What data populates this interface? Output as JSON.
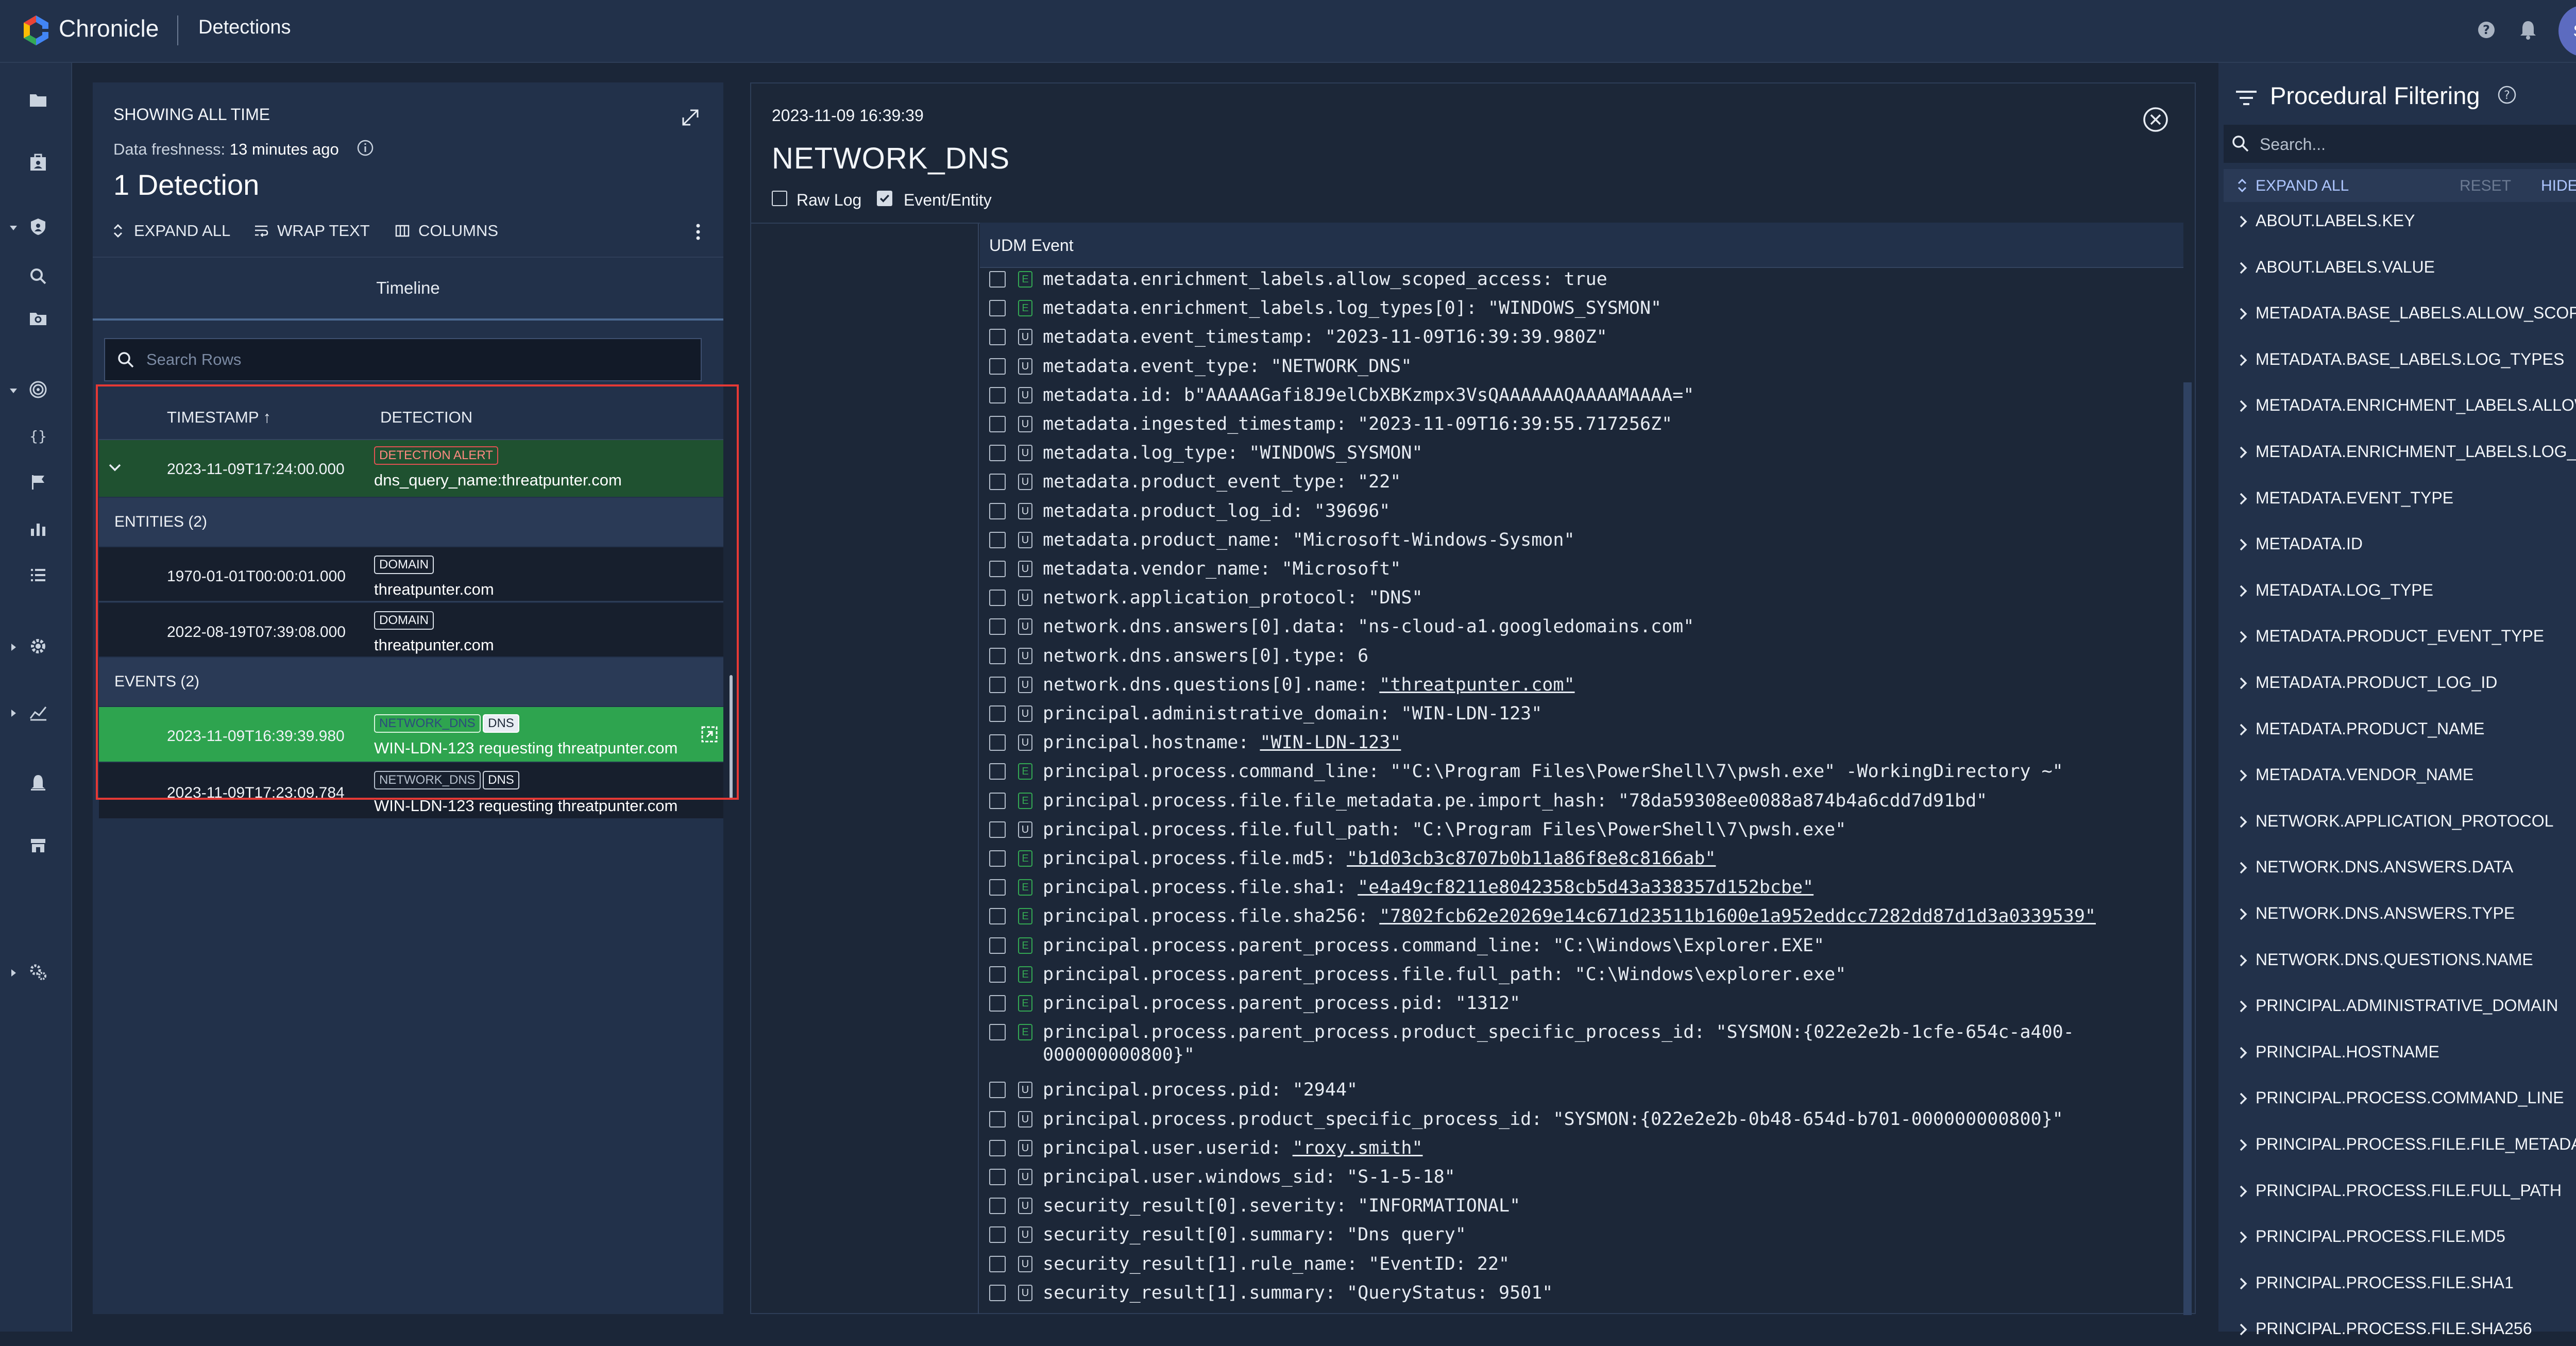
{
  "header": {
    "brand": "Chronicle",
    "page_title": "Detections",
    "avatar_initials": "SA",
    "brand_colors": [
      "#4285f4",
      "#ea4335",
      "#fbbc04",
      "#34a853"
    ]
  },
  "rail_icons": [
    "folder-icon",
    "case-icon",
    "shield-icon",
    "search-icon",
    "folder-search-icon",
    "target-icon",
    "curly-braces-icon",
    "flag-icon",
    "bar-chart-icon",
    "list-icon",
    "gear-icon",
    "line-chart-icon",
    "bell-icon",
    "store-icon",
    "settings-gears-icon"
  ],
  "left": {
    "showing": "SHOWING ALL TIME",
    "freshness_label": "Data freshness:",
    "freshness_value": "13 minutes ago",
    "count_label": "1 Detection",
    "toolbar": {
      "expand_all": "EXPAND ALL",
      "wrap_text": "WRAP TEXT",
      "columns": "COLUMNS"
    },
    "tab": "Timeline",
    "search_placeholder": "Search Rows",
    "columns": {
      "timestamp": "TIMESTAMP ↑",
      "detection": "DETECTION"
    },
    "detection_row": {
      "timestamp": "2023-11-09T17:24:00.000",
      "badge": "DETECTION ALERT",
      "value": "dns_query_name:threatpunter.com"
    },
    "entities_header": "ENTITIES (2)",
    "entities": [
      {
        "timestamp": "1970-01-01T00:00:01.000",
        "badge": "DOMAIN",
        "value": "threatpunter.com"
      },
      {
        "timestamp": "2022-08-19T07:39:08.000",
        "badge": "DOMAIN",
        "value": "threatpunter.com"
      }
    ],
    "events_header": "EVENTS (2)",
    "events": [
      {
        "timestamp": "2023-11-09T16:39:39.980",
        "badge1": "NETWORK_DNS",
        "badge2": "DNS",
        "value": "WIN-LDN-123 requesting threatpunter.com"
      },
      {
        "timestamp": "2023-11-09T17:23:09.784",
        "badge1": "NETWORK_DNS",
        "badge2": "DNS",
        "value": "WIN-LDN-123 requesting threatpunter.com"
      }
    ]
  },
  "middle": {
    "event_date": "2023-11-09 16:39:39",
    "event_title": "NETWORK_DNS",
    "raw_log": "Raw Log",
    "event_entity": "Event/Entity",
    "udm_header": "UDM Event",
    "fields": [
      {
        "tag": "E",
        "text": "metadata.enrichment_labels.allow_scoped_access: true"
      },
      {
        "tag": "E",
        "text": "metadata.enrichment_labels.log_types[0]: \"WINDOWS_SYSMON\""
      },
      {
        "tag": "U",
        "text": "metadata.event_timestamp: \"2023-11-09T16:39:39.980Z\""
      },
      {
        "tag": "U",
        "text": "metadata.event_type: \"NETWORK_DNS\""
      },
      {
        "tag": "U",
        "text": "metadata.id: b\"AAAAAGafi8J9elCbXBKzmpx3VsQAAAAAAQAAAAMAAAA=\""
      },
      {
        "tag": "U",
        "text": "metadata.ingested_timestamp: \"2023-11-09T16:39:55.717256Z\""
      },
      {
        "tag": "U",
        "text": "metadata.log_type: \"WINDOWS_SYSMON\""
      },
      {
        "tag": "U",
        "text": "metadata.product_event_type: \"22\""
      },
      {
        "tag": "U",
        "text": "metadata.product_log_id: \"39696\""
      },
      {
        "tag": "U",
        "text": "metadata.product_name: \"Microsoft-Windows-Sysmon\""
      },
      {
        "tag": "U",
        "text": "metadata.vendor_name: \"Microsoft\""
      },
      {
        "tag": "U",
        "text": "network.application_protocol: \"DNS\""
      },
      {
        "tag": "U",
        "text": "network.dns.answers[0].data: \"ns-cloud-a1.googledomains.com\""
      },
      {
        "tag": "U",
        "text": "network.dns.answers[0].type: 6"
      },
      {
        "tag": "U",
        "text": "network.dns.questions[0].name: ",
        "link": "\"threatpunter.com\""
      },
      {
        "tag": "U",
        "text": "principal.administrative_domain: \"WIN-LDN-123\""
      },
      {
        "tag": "U",
        "text": "principal.hostname: ",
        "link": "\"WIN-LDN-123\""
      },
      {
        "tag": "E",
        "text": "principal.process.command_line: \"\"C:\\Program Files\\PowerShell\\7\\pwsh.exe\" -WorkingDirectory ~\""
      },
      {
        "tag": "E",
        "text": "principal.process.file.file_metadata.pe.import_hash: \"78da59308ee0088a874b4a6cdd7d91bd\""
      },
      {
        "tag": "U",
        "text": "principal.process.file.full_path: \"C:\\Program Files\\PowerShell\\7\\pwsh.exe\""
      },
      {
        "tag": "E",
        "text": "principal.process.file.md5: ",
        "link": "\"b1d03cb3c8707b0b11a86f8e8c8166ab\""
      },
      {
        "tag": "E",
        "text": "principal.process.file.sha1: ",
        "link": "\"e4a49cf8211e8042358cb5d43a338357d152bcbe\""
      },
      {
        "tag": "E",
        "text": "principal.process.file.sha256: ",
        "link": "\"7802fcb62e20269e14c671d23511b1600e1a952eddcc7282dd87d1d3a0339539\""
      },
      {
        "tag": "E",
        "text": "principal.process.parent_process.command_line: \"C:\\Windows\\Explorer.EXE\""
      },
      {
        "tag": "E",
        "text": "principal.process.parent_process.file.full_path: \"C:\\Windows\\explorer.exe\""
      },
      {
        "tag": "E",
        "text": "principal.process.parent_process.pid: \"1312\""
      },
      {
        "tag": "E",
        "text": "principal.process.parent_process.product_specific_process_id: \"SYSMON:{022e2e2b-1cfe-654c-a400-",
        "text2": "000000000800}\""
      },
      {
        "tag": "U",
        "text": "principal.process.pid: \"2944\""
      },
      {
        "tag": "U",
        "text": "principal.process.product_specific_process_id: \"SYSMON:{022e2e2b-0b48-654d-b701-000000000800}\""
      },
      {
        "tag": "U",
        "text": "principal.user.userid: ",
        "link": "\"roxy.smith\""
      },
      {
        "tag": "U",
        "text": "principal.user.windows_sid: \"S-1-5-18\""
      },
      {
        "tag": "U",
        "text": "security_result[0].severity: \"INFORMATIONAL\""
      },
      {
        "tag": "U",
        "text": "security_result[0].summary: \"Dns query\""
      },
      {
        "tag": "U",
        "text": "security_result[1].rule_name: \"EventID: 22\""
      },
      {
        "tag": "U",
        "text": "security_result[1].summary: \"QueryStatus: 9501\""
      }
    ]
  },
  "right": {
    "title": "Procedural Filtering",
    "search_placeholder": "Search...",
    "expand_all": "EXPAND ALL",
    "reset": "RESET",
    "hide_all": "HIDE ALL",
    "items": [
      "ABOUT.LABELS.KEY",
      "ABOUT.LABELS.VALUE",
      "METADATA.BASE_LABELS.ALLOW_SCOPED_ACCESS",
      "METADATA.BASE_LABELS.LOG_TYPES",
      "METADATA.ENRICHMENT_LABELS.ALLOW_SCOPED_ACCESS",
      "METADATA.ENRICHMENT_LABELS.LOG_TYPES",
      "METADATA.EVENT_TYPE",
      "METADATA.ID",
      "METADATA.LOG_TYPE",
      "METADATA.PRODUCT_EVENT_TYPE",
      "METADATA.PRODUCT_LOG_ID",
      "METADATA.PRODUCT_NAME",
      "METADATA.VENDOR_NAME",
      "NETWORK.APPLICATION_PROTOCOL",
      "NETWORK.DNS.ANSWERS.DATA",
      "NETWORK.DNS.ANSWERS.TYPE",
      "NETWORK.DNS.QUESTIONS.NAME",
      "PRINCIPAL.ADMINISTRATIVE_DOMAIN",
      "PRINCIPAL.HOSTNAME",
      "PRINCIPAL.PROCESS.COMMAND_LINE",
      "PRINCIPAL.PROCESS.FILE.FILE_METADATA.PE.IMPORT_HASH",
      "PRINCIPAL.PROCESS.FILE.FULL_PATH",
      "PRINCIPAL.PROCESS.FILE.MD5",
      "PRINCIPAL.PROCESS.FILE.SHA1",
      "PRINCIPAL.PROCESS.FILE.SHA256"
    ]
  },
  "colors": {
    "alert_red": "#e05252",
    "selected_green": "#2ea44f",
    "enrichment_green": "#34a853",
    "link_blue": "#aec6ff"
  }
}
